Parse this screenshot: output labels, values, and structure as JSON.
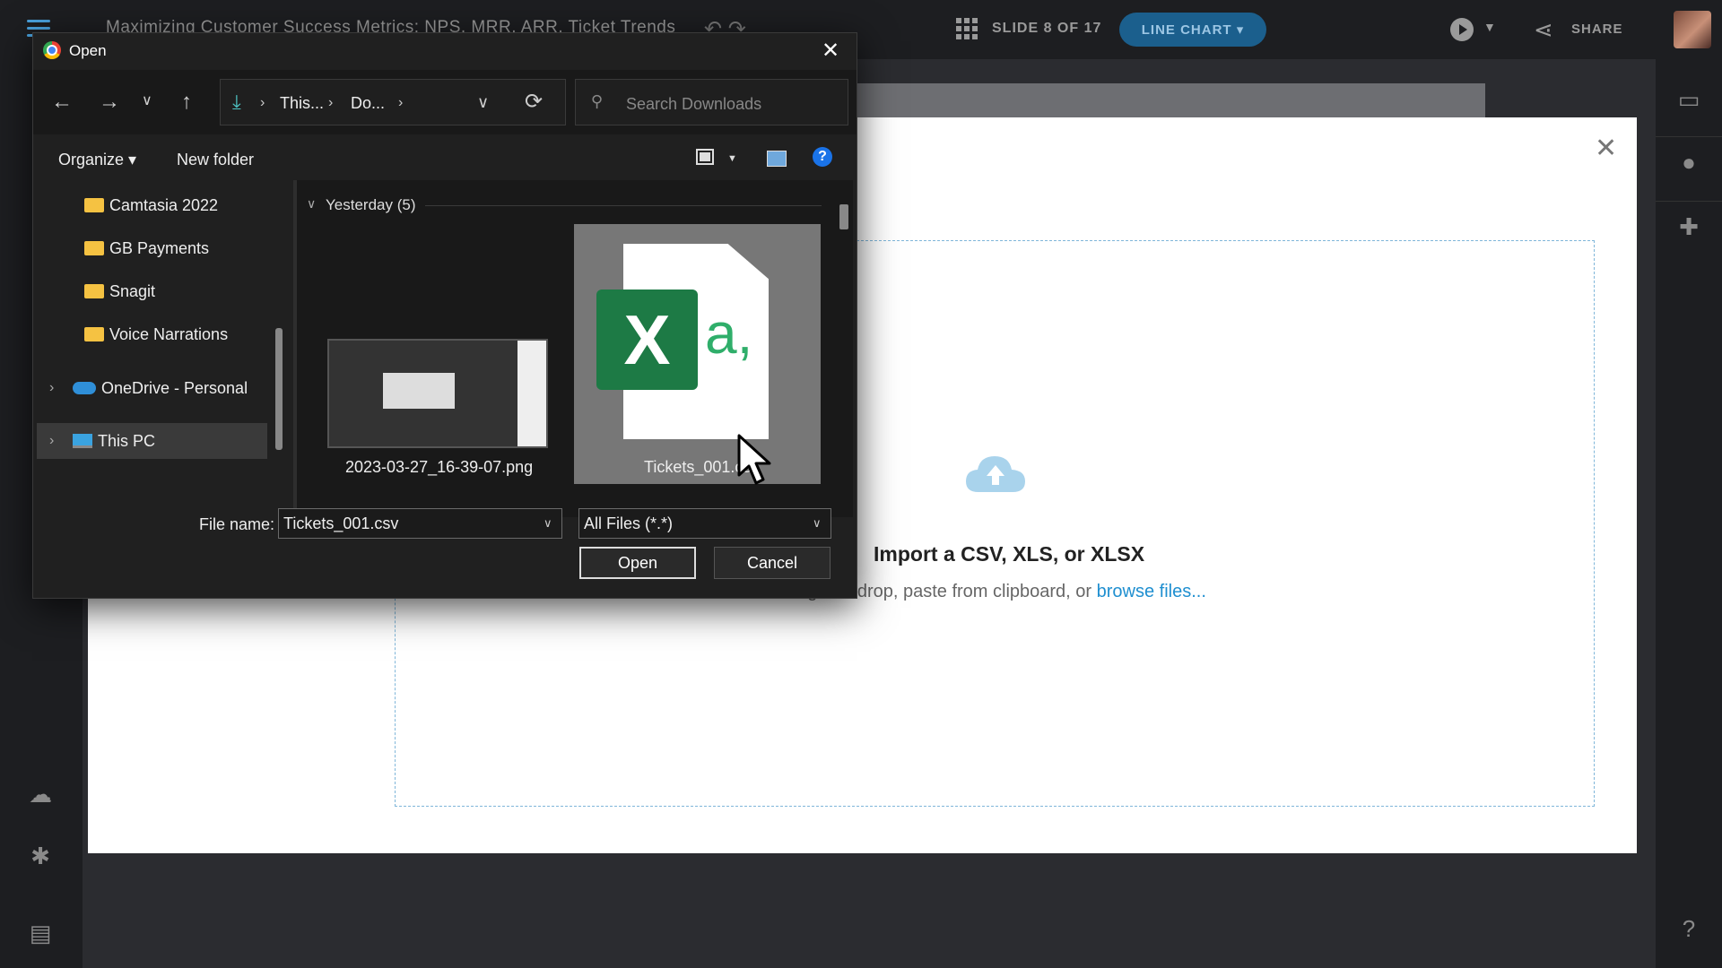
{
  "app": {
    "title": "Maximizing Customer Success Metrics: NPS, MRR, ARR, Ticket Trends",
    "slide_counter": "SLIDE 8 OF 17",
    "chart_type_label": "LINE CHART ▾",
    "share_label": "SHARE"
  },
  "import_modal": {
    "title": "Import a CSV, XLS, or XLSX",
    "subtitle_prefix": "Drag and drop, paste from clipboard, or ",
    "browse_link": "browse files..."
  },
  "dialog": {
    "title": "Open",
    "address": [
      "This...",
      "Do..."
    ],
    "search_placeholder": "Search Downloads",
    "organize_label": "Organize ▾",
    "new_folder_label": "New folder",
    "help_label": "?",
    "tree": [
      {
        "label": "Camtasia 2022",
        "icon": "folder-icon"
      },
      {
        "label": "GB Payments",
        "icon": "folder-icon"
      },
      {
        "label": "Snagit",
        "icon": "folder-icon"
      },
      {
        "label": "Voice Narrations",
        "icon": "folder-icon"
      },
      {
        "label": "OneDrive - Personal",
        "icon": "onedrive-icon"
      },
      {
        "label": "This PC",
        "icon": "this-pc-icon"
      }
    ],
    "group_header": "Yesterday (5)",
    "files": [
      {
        "label": "2023-03-27_16-39-07.png"
      },
      {
        "label": "Tickets_001.csv",
        "icon_letter": "X",
        "icon_glyph": "a,"
      }
    ],
    "file_name_label": "File name:",
    "file_name_value": "Tickets_001.csv",
    "file_type_value": "All Files (*.*)",
    "open_label": "Open",
    "cancel_label": "Cancel"
  },
  "colors": {
    "accent": "#1f8fd0",
    "excel_green": "#1d7a45",
    "pill_bg": "#1b5f8d"
  }
}
